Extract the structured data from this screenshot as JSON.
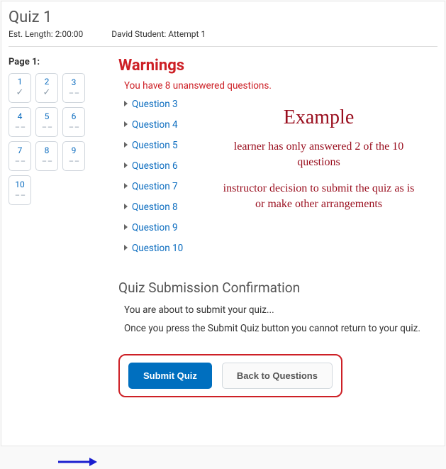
{
  "header": {
    "title": "Quiz 1",
    "est_length_label": "Est. Length: 2:00:00",
    "attempt_label": "David Student: Attempt 1"
  },
  "nav": {
    "page_label": "Page 1:",
    "cells": [
      {
        "num": "1",
        "answered": true
      },
      {
        "num": "2",
        "answered": true
      },
      {
        "num": "3",
        "answered": false
      },
      {
        "num": "4",
        "answered": false
      },
      {
        "num": "5",
        "answered": false
      },
      {
        "num": "6",
        "answered": false
      },
      {
        "num": "7",
        "answered": false
      },
      {
        "num": "8",
        "answered": false
      },
      {
        "num": "9",
        "answered": false
      },
      {
        "num": "10",
        "answered": false
      }
    ]
  },
  "warnings": {
    "title": "Warnings",
    "unanswered_msg": "You have 8 unanswered questions.",
    "questions": [
      "Question 3",
      "Question 4",
      "Question 5",
      "Question 6",
      "Question 7",
      "Question 8",
      "Question 9",
      "Question 10"
    ]
  },
  "annotation": {
    "title": "Example",
    "line1": "learner has only answered 2 of the 10 questions",
    "line2": "instructor decision to submit the quiz as is or make other arrangements"
  },
  "confirm": {
    "title": "Quiz Submission Confirmation",
    "line1": "You are about to submit your quiz...",
    "line2": "Once you press the Submit Quiz button you cannot return to your quiz."
  },
  "buttons": {
    "submit": "Submit Quiz",
    "back": "Back to Questions"
  }
}
